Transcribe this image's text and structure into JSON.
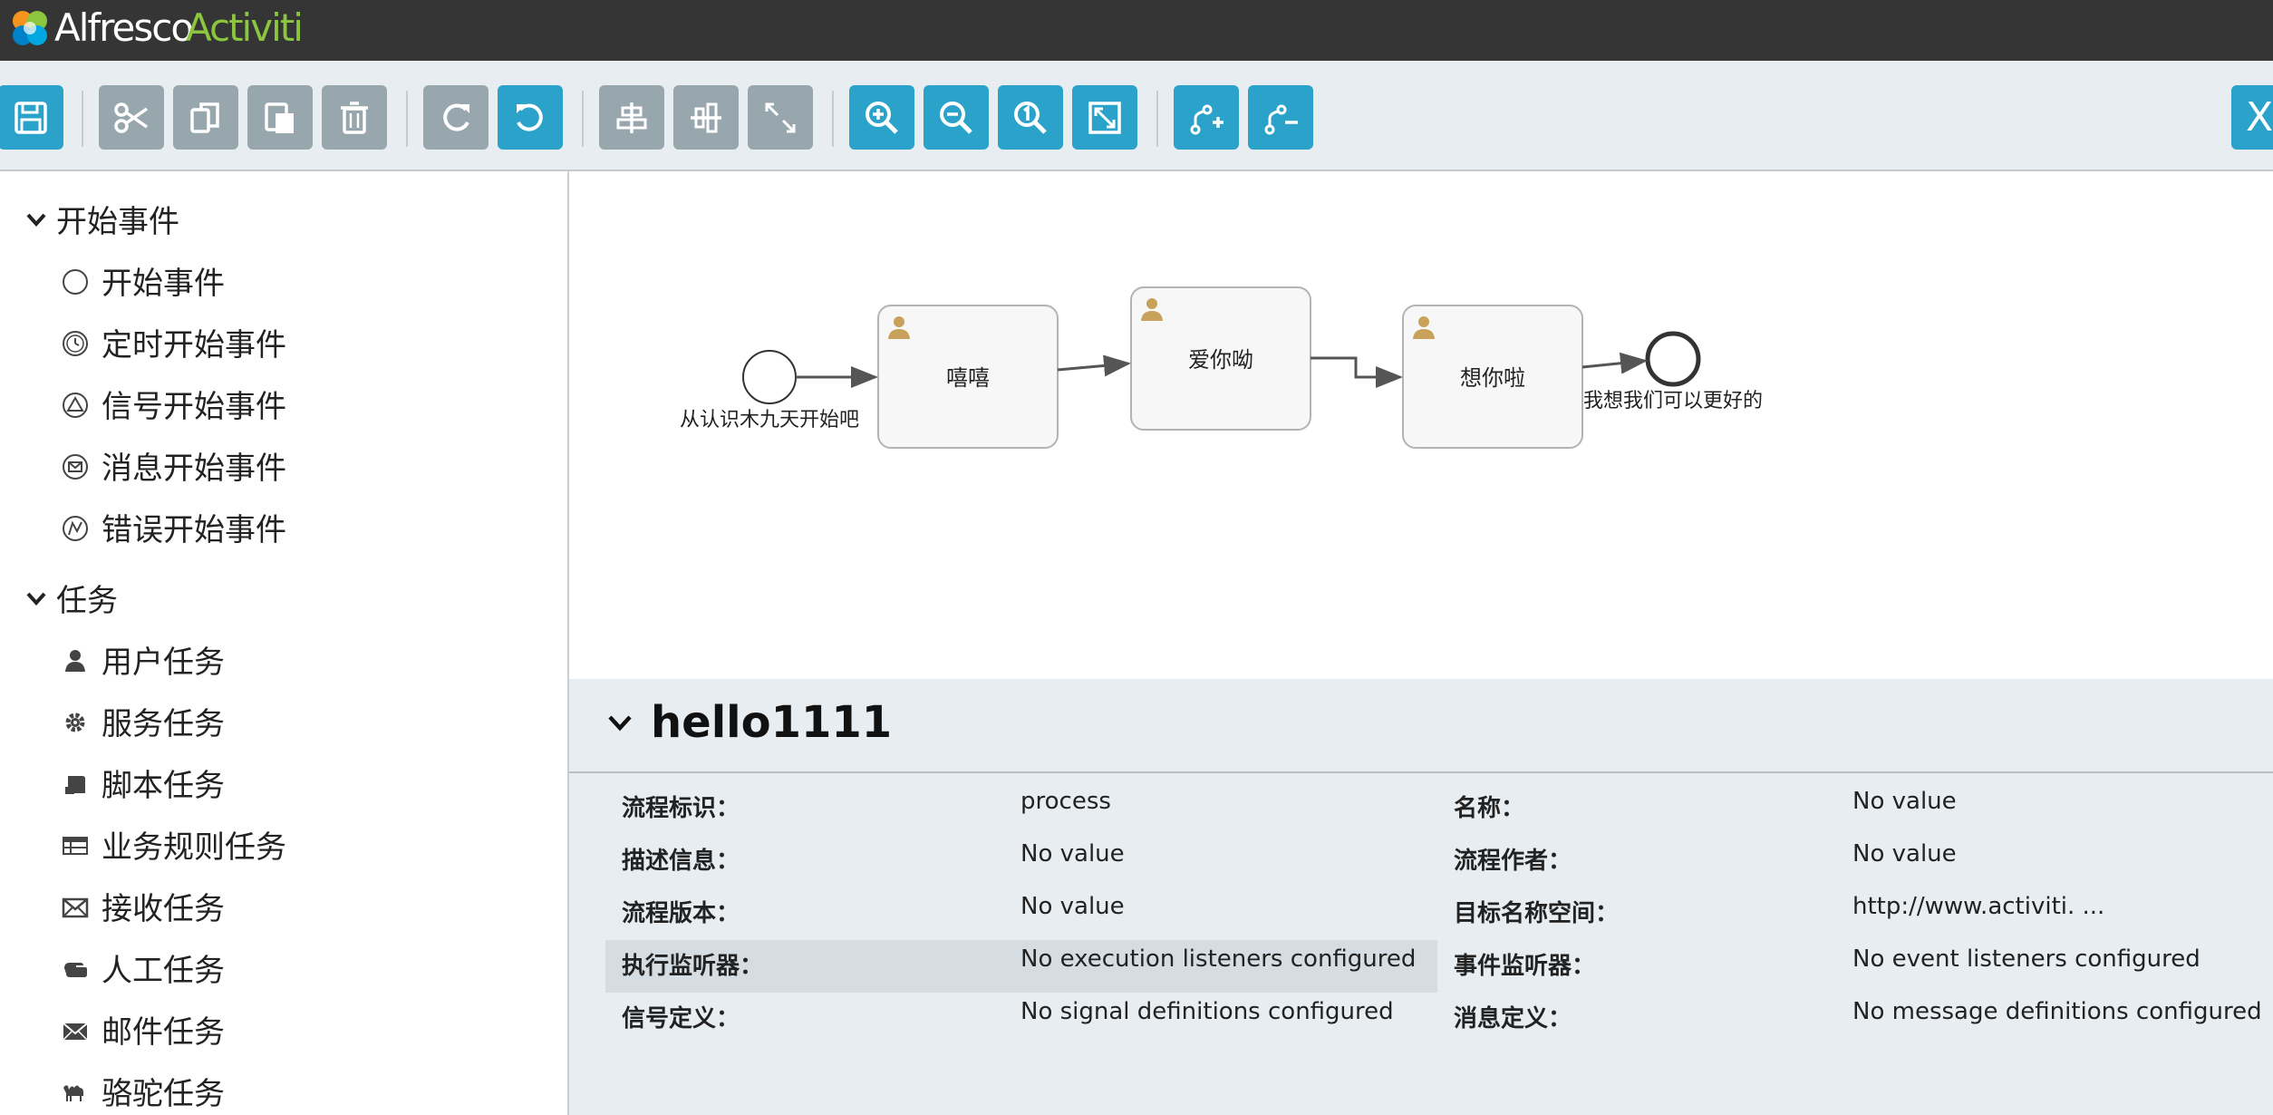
{
  "header": {
    "logo_alfresco": "Alfresco",
    "logo_activiti": "Activiti"
  },
  "toolbar": {
    "buttons": [
      "save-icon",
      "cut-icon",
      "copy-icon",
      "paste-icon",
      "delete-icon",
      "redo-icon",
      "undo-icon",
      "align-horizontal-icon",
      "align-vertical-icon",
      "same-size-icon",
      "zoom-in-icon",
      "zoom-out-icon",
      "zoom-actual-icon",
      "zoom-fit-icon",
      "add-bendpoint-icon",
      "remove-bendpoint-icon",
      "close-icon"
    ],
    "close_label": "X"
  },
  "palette": {
    "groups": [
      {
        "label": "开始事件",
        "items": [
          {
            "label": "开始事件",
            "icon": "circle-icon"
          },
          {
            "label": "定时开始事件",
            "icon": "timer-icon"
          },
          {
            "label": "信号开始事件",
            "icon": "signal-icon"
          },
          {
            "label": "消息开始事件",
            "icon": "message-icon"
          },
          {
            "label": "错误开始事件",
            "icon": "error-icon"
          }
        ]
      },
      {
        "label": "任务",
        "items": [
          {
            "label": "用户任务",
            "icon": "user-icon"
          },
          {
            "label": "服务任务",
            "icon": "gear-icon"
          },
          {
            "label": "脚本任务",
            "icon": "script-icon"
          },
          {
            "label": "业务规则任务",
            "icon": "table-icon"
          },
          {
            "label": "接收任务",
            "icon": "envelope-icon"
          },
          {
            "label": "人工任务",
            "icon": "hand-icon"
          },
          {
            "label": "邮件任务",
            "icon": "mail-icon"
          },
          {
            "label": "骆驼任务",
            "icon": "camel-icon"
          }
        ]
      }
    ]
  },
  "diagram": {
    "start_label": "从认识木九天开始吧",
    "task1": "嘻嘻",
    "task2": "爱你呦",
    "task3": "想你啦",
    "end_label": "我想我们可以更好的"
  },
  "properties": {
    "title": "hello1111",
    "rows": [
      {
        "l1": "流程标识：",
        "v1": "process",
        "l2": "名称：",
        "v2": "No value"
      },
      {
        "l1": "描述信息：",
        "v1": "No value",
        "l2": "流程作者：",
        "v2": "No value"
      },
      {
        "l1": "流程版本：",
        "v1": "No value",
        "l2": "目标名称空间：",
        "v2": "http://www.activiti. ..."
      },
      {
        "l1": "执行监听器：",
        "v1": "No execution listeners configured",
        "l2": "事件监听器：",
        "v2": "No event listeners configured"
      },
      {
        "l1": "信号定义：",
        "v1": "No signal definitions configured",
        "l2": "消息定义：",
        "v2": "No message definitions configured"
      }
    ]
  },
  "colors": {
    "header_bg": "#353535",
    "toolbar_bg": "#e8edf1",
    "button_blue": "#2aa2c9",
    "button_gray": "#98a7ad",
    "logo_green": "#8cc63f",
    "user_icon": "#c8a25a"
  }
}
